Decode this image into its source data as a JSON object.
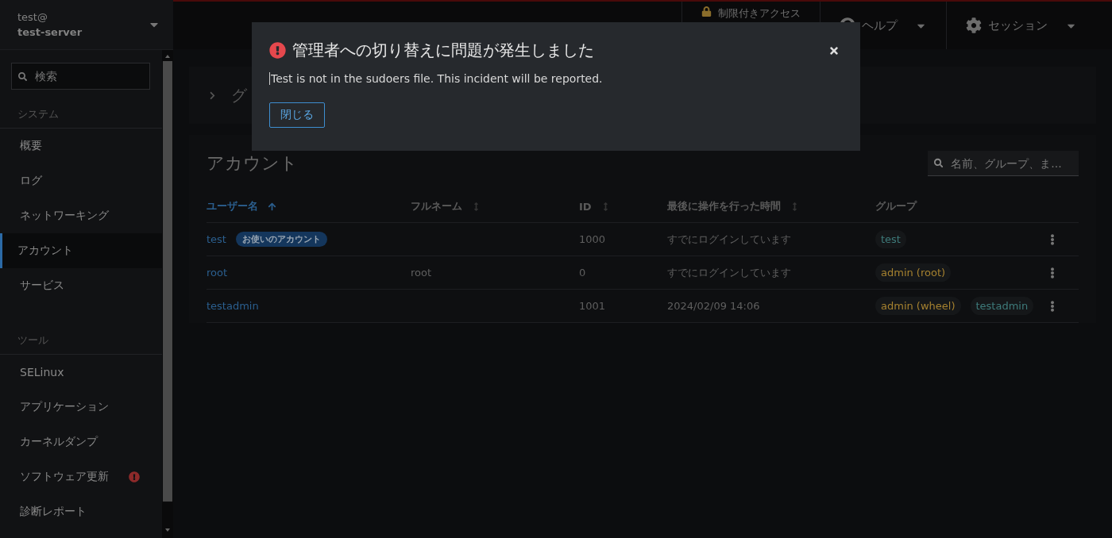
{
  "host": {
    "user": "test@",
    "server": "test-server"
  },
  "topbar": {
    "restricted": "制限付きアクセス",
    "help": "ヘルプ",
    "session": "セッション"
  },
  "sidebar": {
    "search": {
      "placeholder": "検索"
    },
    "sections": [
      {
        "title": "システム",
        "items": [
          {
            "label": "概要",
            "selected": false
          },
          {
            "label": "ログ",
            "selected": false
          },
          {
            "label": "ネットワーキング",
            "selected": false
          },
          {
            "label": "アカウント",
            "selected": true
          },
          {
            "label": "サービス",
            "selected": false
          }
        ]
      },
      {
        "title": "ツール",
        "items": [
          {
            "label": "SELinux",
            "selected": false
          },
          {
            "label": "アプリケーション",
            "selected": false
          },
          {
            "label": "カーネルダンプ",
            "selected": false
          },
          {
            "label": "ソフトウェア更新",
            "selected": false,
            "alert": true
          },
          {
            "label": "診断レポート",
            "selected": false
          }
        ]
      }
    ]
  },
  "breadcrumb": "グ",
  "accounts": {
    "title": "アカウント",
    "search": {
      "placeholder": "名前、グループ、ま..."
    },
    "columns": [
      {
        "label": "ユーザー名",
        "sortable": true,
        "sorted": true
      },
      {
        "label": "フルネーム",
        "sortable": true,
        "sorted": false
      },
      {
        "label": "ID",
        "sortable": true,
        "sorted": false
      },
      {
        "label": "最後に操作を行った時間",
        "sortable": true,
        "sorted": false
      },
      {
        "label": "グループ",
        "sortable": false,
        "sorted": false
      }
    ],
    "rows": [
      {
        "username": "test",
        "badge": "お使いのアカウント",
        "fullname": "",
        "id": "1000",
        "last": "すでにログインしています",
        "groups": [
          {
            "name": "test",
            "color": "#3e7b7b"
          }
        ]
      },
      {
        "username": "root",
        "fullname": "root",
        "id": "0",
        "last": "すでにログインしています",
        "groups": [
          {
            "name": "admin (root)",
            "color": "#a5812f"
          }
        ]
      },
      {
        "username": "testadmin",
        "fullname": "",
        "id": "1001",
        "last": "2024/02/09 14:06",
        "groups": [
          {
            "name": "admin (wheel)",
            "color": "#a5812f"
          },
          {
            "name": "testadmin",
            "color": "#3e7b7b"
          }
        ]
      }
    ]
  },
  "dialog": {
    "title": "管理者への切り替えに問題が発生しました",
    "message": "Test is not in the sudoers file. This incident will be reported.",
    "button": "閉じる"
  }
}
